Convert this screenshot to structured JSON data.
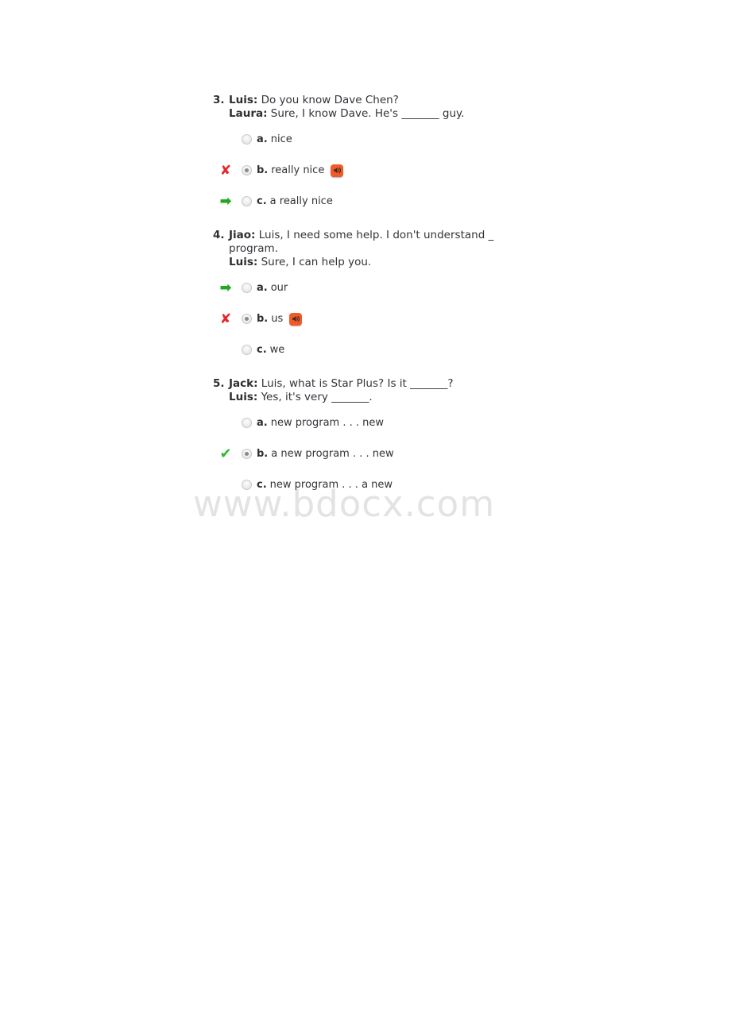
{
  "watermark": {
    "text": "www.bdocx.com"
  },
  "quiz": {
    "questions": [
      {
        "number": "3.",
        "lines": [
          {
            "speaker": "Luis:",
            "text": " Do you know Dave Chen?"
          },
          {
            "speaker": "Laura:",
            "text": " Sure, I know Dave. He's _______ guy."
          }
        ],
        "options": [
          {
            "mark": "none",
            "mark_glyph": "",
            "selected": false,
            "letter": "a.",
            "text": "nice",
            "audio": false
          },
          {
            "mark": "wrong",
            "mark_glyph": "✘",
            "selected": true,
            "letter": "b.",
            "text": "really nice",
            "audio": true
          },
          {
            "mark": "arrow",
            "mark_glyph": "➡",
            "selected": false,
            "letter": "c.",
            "text": "a really nice",
            "audio": false
          }
        ]
      },
      {
        "number": "4.",
        "lines": [
          {
            "speaker": "Jiao:",
            "text": " Luis, I need some help. I don't understand _"
          },
          {
            "speaker": "",
            "text": "program."
          },
          {
            "speaker": "Luis:",
            "text": " Sure, I can help you."
          }
        ],
        "options": [
          {
            "mark": "arrow",
            "mark_glyph": "➡",
            "selected": false,
            "letter": "a.",
            "text": "our",
            "audio": false
          },
          {
            "mark": "wrong",
            "mark_glyph": "✘",
            "selected": true,
            "letter": "b.",
            "text": "us",
            "audio": true
          },
          {
            "mark": "none",
            "mark_glyph": "",
            "selected": false,
            "letter": "c.",
            "text": "we",
            "audio": false
          }
        ]
      },
      {
        "number": "5.",
        "lines": [
          {
            "speaker": "Jack:",
            "text": " Luis, what is Star Plus? Is it _______?"
          },
          {
            "speaker": "Luis:",
            "text": " Yes, it's very _______."
          }
        ],
        "options": [
          {
            "mark": "none",
            "mark_glyph": "",
            "selected": false,
            "letter": "a.",
            "text": "new program . . . new",
            "audio": false
          },
          {
            "mark": "check",
            "mark_glyph": "✔",
            "selected": true,
            "letter": "b.",
            "text": "a new program . . . new",
            "audio": false
          },
          {
            "mark": "none",
            "mark_glyph": "",
            "selected": false,
            "letter": "c.",
            "text": "new program . . . a new",
            "audio": false
          }
        ]
      }
    ]
  },
  "colors": {
    "wrong_mark": "#e8262b",
    "arrow_mark": "#21a821",
    "check_mark": "#2eb82e",
    "audio_badge": "#f05a28",
    "text": "#33333a",
    "watermark": "#e3e3e3"
  },
  "icons": {
    "audio_badge": "speaker-audio-icon",
    "wrong": "cross-mark-icon",
    "arrow": "right-arrow-icon",
    "check": "check-mark-icon",
    "radio": "radio-button-icon"
  }
}
